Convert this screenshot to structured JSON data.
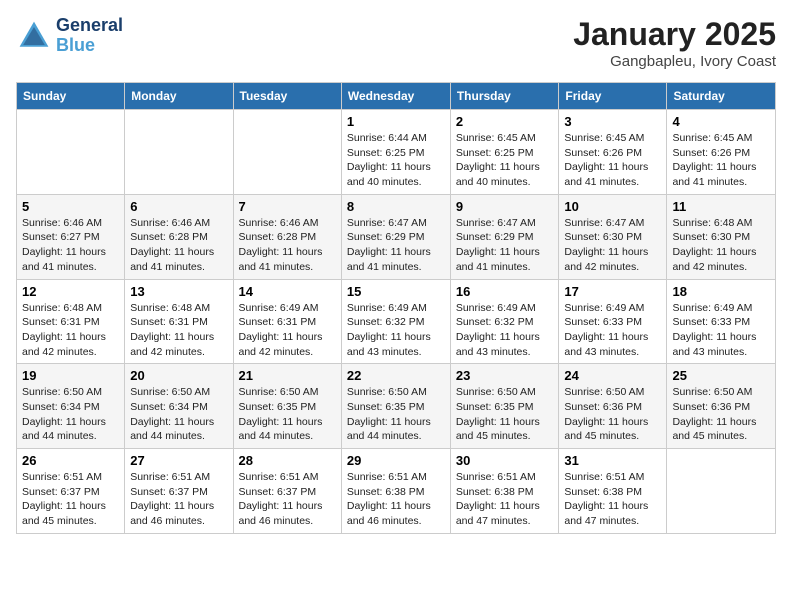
{
  "logo": {
    "line1": "General",
    "line2": "Blue"
  },
  "title": "January 2025",
  "location": "Gangbapleu, Ivory Coast",
  "days_header": [
    "Sunday",
    "Monday",
    "Tuesday",
    "Wednesday",
    "Thursday",
    "Friday",
    "Saturday"
  ],
  "weeks": [
    [
      {
        "num": "",
        "sunrise": "",
        "sunset": "",
        "daylight": ""
      },
      {
        "num": "",
        "sunrise": "",
        "sunset": "",
        "daylight": ""
      },
      {
        "num": "",
        "sunrise": "",
        "sunset": "",
        "daylight": ""
      },
      {
        "num": "1",
        "sunrise": "Sunrise: 6:44 AM",
        "sunset": "Sunset: 6:25 PM",
        "daylight": "Daylight: 11 hours and 40 minutes."
      },
      {
        "num": "2",
        "sunrise": "Sunrise: 6:45 AM",
        "sunset": "Sunset: 6:25 PM",
        "daylight": "Daylight: 11 hours and 40 minutes."
      },
      {
        "num": "3",
        "sunrise": "Sunrise: 6:45 AM",
        "sunset": "Sunset: 6:26 PM",
        "daylight": "Daylight: 11 hours and 41 minutes."
      },
      {
        "num": "4",
        "sunrise": "Sunrise: 6:45 AM",
        "sunset": "Sunset: 6:26 PM",
        "daylight": "Daylight: 11 hours and 41 minutes."
      }
    ],
    [
      {
        "num": "5",
        "sunrise": "Sunrise: 6:46 AM",
        "sunset": "Sunset: 6:27 PM",
        "daylight": "Daylight: 11 hours and 41 minutes."
      },
      {
        "num": "6",
        "sunrise": "Sunrise: 6:46 AM",
        "sunset": "Sunset: 6:28 PM",
        "daylight": "Daylight: 11 hours and 41 minutes."
      },
      {
        "num": "7",
        "sunrise": "Sunrise: 6:46 AM",
        "sunset": "Sunset: 6:28 PM",
        "daylight": "Daylight: 11 hours and 41 minutes."
      },
      {
        "num": "8",
        "sunrise": "Sunrise: 6:47 AM",
        "sunset": "Sunset: 6:29 PM",
        "daylight": "Daylight: 11 hours and 41 minutes."
      },
      {
        "num": "9",
        "sunrise": "Sunrise: 6:47 AM",
        "sunset": "Sunset: 6:29 PM",
        "daylight": "Daylight: 11 hours and 41 minutes."
      },
      {
        "num": "10",
        "sunrise": "Sunrise: 6:47 AM",
        "sunset": "Sunset: 6:30 PM",
        "daylight": "Daylight: 11 hours and 42 minutes."
      },
      {
        "num": "11",
        "sunrise": "Sunrise: 6:48 AM",
        "sunset": "Sunset: 6:30 PM",
        "daylight": "Daylight: 11 hours and 42 minutes."
      }
    ],
    [
      {
        "num": "12",
        "sunrise": "Sunrise: 6:48 AM",
        "sunset": "Sunset: 6:31 PM",
        "daylight": "Daylight: 11 hours and 42 minutes."
      },
      {
        "num": "13",
        "sunrise": "Sunrise: 6:48 AM",
        "sunset": "Sunset: 6:31 PM",
        "daylight": "Daylight: 11 hours and 42 minutes."
      },
      {
        "num": "14",
        "sunrise": "Sunrise: 6:49 AM",
        "sunset": "Sunset: 6:31 PM",
        "daylight": "Daylight: 11 hours and 42 minutes."
      },
      {
        "num": "15",
        "sunrise": "Sunrise: 6:49 AM",
        "sunset": "Sunset: 6:32 PM",
        "daylight": "Daylight: 11 hours and 43 minutes."
      },
      {
        "num": "16",
        "sunrise": "Sunrise: 6:49 AM",
        "sunset": "Sunset: 6:32 PM",
        "daylight": "Daylight: 11 hours and 43 minutes."
      },
      {
        "num": "17",
        "sunrise": "Sunrise: 6:49 AM",
        "sunset": "Sunset: 6:33 PM",
        "daylight": "Daylight: 11 hours and 43 minutes."
      },
      {
        "num": "18",
        "sunrise": "Sunrise: 6:49 AM",
        "sunset": "Sunset: 6:33 PM",
        "daylight": "Daylight: 11 hours and 43 minutes."
      }
    ],
    [
      {
        "num": "19",
        "sunrise": "Sunrise: 6:50 AM",
        "sunset": "Sunset: 6:34 PM",
        "daylight": "Daylight: 11 hours and 44 minutes."
      },
      {
        "num": "20",
        "sunrise": "Sunrise: 6:50 AM",
        "sunset": "Sunset: 6:34 PM",
        "daylight": "Daylight: 11 hours and 44 minutes."
      },
      {
        "num": "21",
        "sunrise": "Sunrise: 6:50 AM",
        "sunset": "Sunset: 6:35 PM",
        "daylight": "Daylight: 11 hours and 44 minutes."
      },
      {
        "num": "22",
        "sunrise": "Sunrise: 6:50 AM",
        "sunset": "Sunset: 6:35 PM",
        "daylight": "Daylight: 11 hours and 44 minutes."
      },
      {
        "num": "23",
        "sunrise": "Sunrise: 6:50 AM",
        "sunset": "Sunset: 6:35 PM",
        "daylight": "Daylight: 11 hours and 45 minutes."
      },
      {
        "num": "24",
        "sunrise": "Sunrise: 6:50 AM",
        "sunset": "Sunset: 6:36 PM",
        "daylight": "Daylight: 11 hours and 45 minutes."
      },
      {
        "num": "25",
        "sunrise": "Sunrise: 6:50 AM",
        "sunset": "Sunset: 6:36 PM",
        "daylight": "Daylight: 11 hours and 45 minutes."
      }
    ],
    [
      {
        "num": "26",
        "sunrise": "Sunrise: 6:51 AM",
        "sunset": "Sunset: 6:37 PM",
        "daylight": "Daylight: 11 hours and 45 minutes."
      },
      {
        "num": "27",
        "sunrise": "Sunrise: 6:51 AM",
        "sunset": "Sunset: 6:37 PM",
        "daylight": "Daylight: 11 hours and 46 minutes."
      },
      {
        "num": "28",
        "sunrise": "Sunrise: 6:51 AM",
        "sunset": "Sunset: 6:37 PM",
        "daylight": "Daylight: 11 hours and 46 minutes."
      },
      {
        "num": "29",
        "sunrise": "Sunrise: 6:51 AM",
        "sunset": "Sunset: 6:38 PM",
        "daylight": "Daylight: 11 hours and 46 minutes."
      },
      {
        "num": "30",
        "sunrise": "Sunrise: 6:51 AM",
        "sunset": "Sunset: 6:38 PM",
        "daylight": "Daylight: 11 hours and 47 minutes."
      },
      {
        "num": "31",
        "sunrise": "Sunrise: 6:51 AM",
        "sunset": "Sunset: 6:38 PM",
        "daylight": "Daylight: 11 hours and 47 minutes."
      },
      {
        "num": "",
        "sunrise": "",
        "sunset": "",
        "daylight": ""
      }
    ]
  ]
}
